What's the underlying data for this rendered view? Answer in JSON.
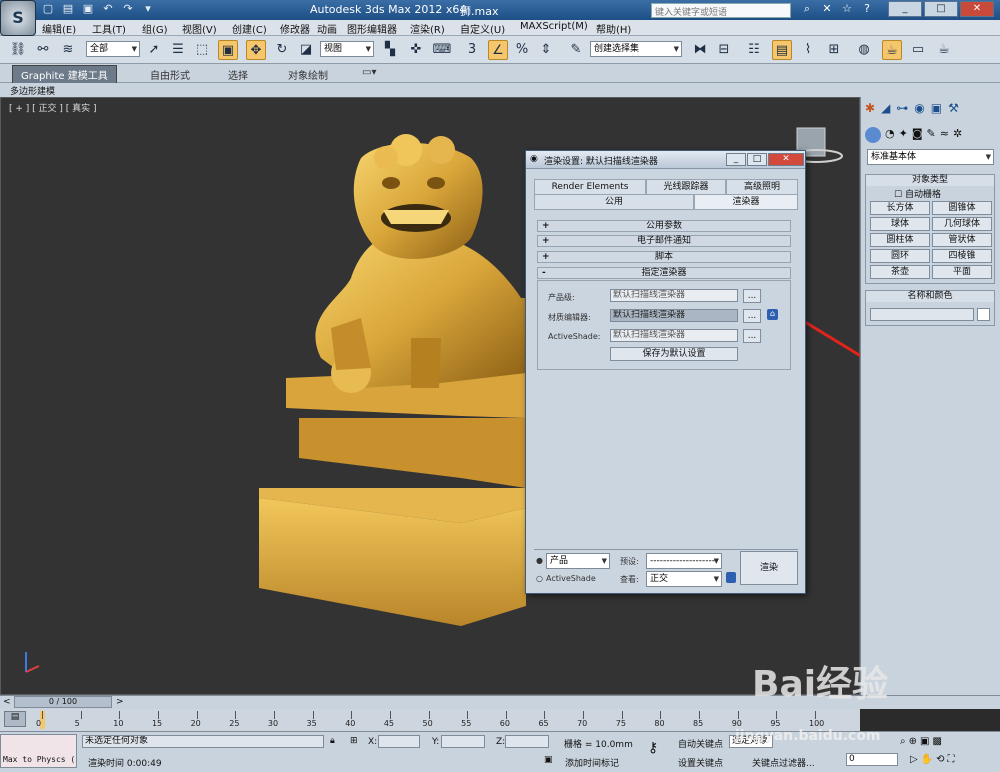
{
  "window": {
    "title": "Autodesk 3ds Max  2012 x64",
    "file": "狮.max",
    "search_placeholder": "键入关键字或短语"
  },
  "menu": [
    "编辑(E)",
    "工具(T)",
    "组(G)",
    "视图(V)",
    "创建(C)",
    "修改器",
    "动画",
    "图形编辑器",
    "渲染(R)",
    "自定义(U)",
    "MAXScript(M)",
    "帮助(H)"
  ],
  "toolbar": {
    "selection_filter": "全部",
    "ref_coord": "视图",
    "named_selection": "创建选择集"
  },
  "ribbon": {
    "tabs": [
      "Graphite 建模工具",
      "自由形式",
      "选择",
      "对象绘制"
    ],
    "active_tab": "Graphite 建模工具",
    "panel": "多边形建模"
  },
  "viewport": {
    "label": "[ + ] [ 正交 ] [ 真实 ]"
  },
  "dialog": {
    "title": "渲染设置: 默认扫描线渲染器",
    "tabs_row1": [
      "Render Elements",
      "光线跟踪器",
      "高级照明"
    ],
    "tabs_row2": [
      "公用",
      "渲染器"
    ],
    "rollouts": [
      {
        "sign": "+",
        "label": "公用参数"
      },
      {
        "sign": "+",
        "label": "电子邮件通知"
      },
      {
        "sign": "+",
        "label": "脚本"
      },
      {
        "sign": "-",
        "label": "指定渲染器"
      }
    ],
    "assign": {
      "production_label": "产品级:",
      "production_value": "默认扫描线渲染器",
      "material_label": "材质编辑器:",
      "material_value": "默认扫描线渲染器",
      "activeshade_label": "ActiveShade:",
      "activeshade_value": "默认扫描线渲染器",
      "browse": "...",
      "save_default": "保存为默认设置"
    },
    "bottom": {
      "mode_production": "产品",
      "mode_activeshade": "ActiveShade",
      "preset_label": "预设:",
      "preset_value": "--------------------",
      "view_label": "查看:",
      "view_value": "正交",
      "render_button": "渲染"
    }
  },
  "command_panel": {
    "category": "标准基本体",
    "object_type_title": "对象类型",
    "autogrid": "自动栅格",
    "objects": [
      "长方体",
      "圆锥体",
      "球体",
      "几何球体",
      "圆柱体",
      "管状体",
      "圆环",
      "四棱锥",
      "茶壶",
      "平面"
    ],
    "name_color_title": "名称和颜色"
  },
  "timeline": {
    "frame": "0 / 100",
    "ticks": [
      "0",
      "5",
      "10",
      "15",
      "20",
      "25",
      "30",
      "35",
      "40",
      "45",
      "50",
      "55",
      "60",
      "65",
      "70",
      "75",
      "80",
      "85",
      "90",
      "95",
      "100"
    ]
  },
  "status": {
    "script": "Max to Physcs (",
    "selection": "未选定任何对象",
    "render_time": "渲染时间  0:00:49",
    "x_label": "X:",
    "y_label": "Y:",
    "z_label": "Z:",
    "grid": "栅格 = 10.0mm",
    "add_time_tag": "添加时间标记",
    "auto_key": "自动关键点",
    "set_key": "设置关键点",
    "selected": "选定对象",
    "key_filters": "关键点过滤器...",
    "frame_value": "0"
  },
  "watermark": {
    "brand": "Bai经验",
    "url": "jingyan.baidu.com"
  },
  "colors": {
    "accent_red": "#e0241b",
    "highlight": "#f5c66b",
    "dialog_bg": "#cbd5e0"
  }
}
